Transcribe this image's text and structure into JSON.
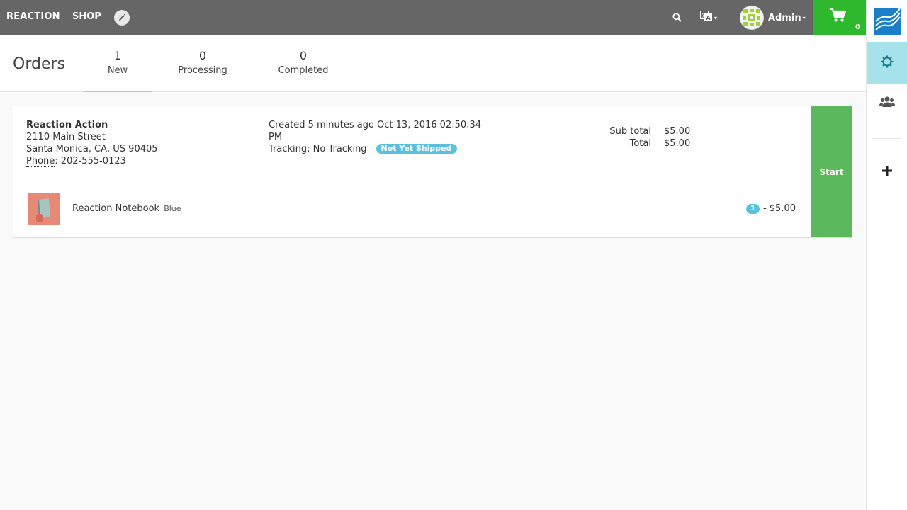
{
  "navbar": {
    "brand": "REACTION",
    "shop_label": "SHOP",
    "edit_icon": "pencil-icon",
    "search_icon": "search-icon",
    "language_icon": "translate-icon",
    "user_name": "Admin",
    "cart_count": "0",
    "cart_color": "#2eb82e"
  },
  "admin_bar": {
    "logo_icon": "reaction-logo",
    "settings_icon": "gear-icon",
    "users_icon": "users-icon",
    "add_icon": "plus-icon",
    "active_color": "#a6e2ec"
  },
  "orders": {
    "title": "Orders",
    "filters": [
      {
        "count": "1",
        "label": "New"
      },
      {
        "count": "0",
        "label": "Processing"
      },
      {
        "count": "0",
        "label": "Completed"
      }
    ]
  },
  "order": {
    "customer_name": "Reaction Action",
    "address_line1": "2110 Main Street",
    "address_line2": "Santa Monica, CA, US 90405",
    "phone_label": "Phone",
    "phone": ": 202-555-0123",
    "created": "Created 5 minutes ago Oct 13, 2016 02:50:34 PM",
    "tracking": "Tracking: No Tracking -",
    "status": "Not Yet Shipped",
    "subtotal_label": "Sub total",
    "subtotal": "$5.00",
    "total_label": "Total",
    "total": "$5.00",
    "start_label": "Start",
    "items": [
      {
        "name": "Reaction Notebook",
        "variant": "Blue",
        "quantity": "1",
        "price": "- $5.00"
      }
    ]
  }
}
